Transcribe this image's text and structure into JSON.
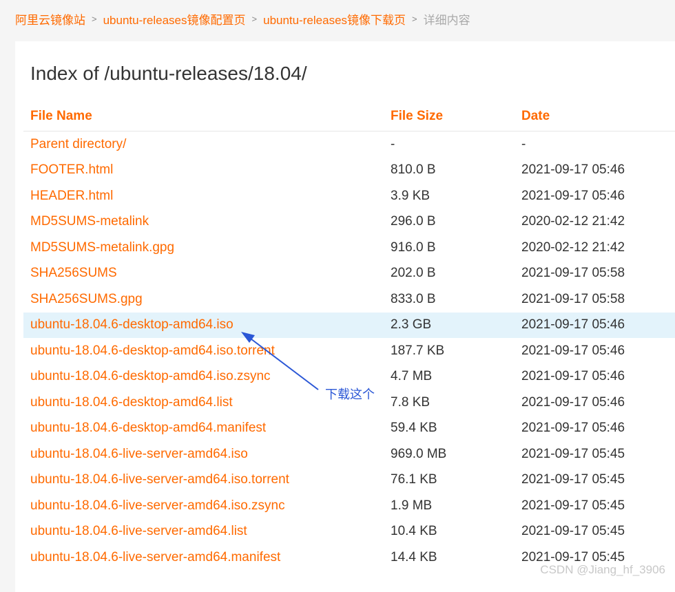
{
  "breadcrumb": {
    "items": [
      "阿里云镜像站",
      "ubuntu-releases镜像配置页",
      "ubuntu-releases镜像下载页"
    ],
    "current": "详细内容",
    "separator": ">"
  },
  "page": {
    "title": "Index of /ubuntu-releases/18.04/"
  },
  "table": {
    "columns": [
      "File Name",
      "File Size",
      "Date"
    ],
    "rows": [
      {
        "name": "Parent directory/",
        "size": "-",
        "date": "-"
      },
      {
        "name": "FOOTER.html",
        "size": "810.0 B",
        "date": "2021-09-17 05:46"
      },
      {
        "name": "HEADER.html",
        "size": "3.9 KB",
        "date": "2021-09-17 05:46"
      },
      {
        "name": "MD5SUMS-metalink",
        "size": "296.0 B",
        "date": "2020-02-12 21:42"
      },
      {
        "name": "MD5SUMS-metalink.gpg",
        "size": "916.0 B",
        "date": "2020-02-12 21:42"
      },
      {
        "name": "SHA256SUMS",
        "size": "202.0 B",
        "date": "2021-09-17 05:58"
      },
      {
        "name": "SHA256SUMS.gpg",
        "size": "833.0 B",
        "date": "2021-09-17 05:58"
      },
      {
        "name": "ubuntu-18.04.6-desktop-amd64.iso",
        "size": "2.3 GB",
        "date": "2021-09-17 05:46"
      },
      {
        "name": "ubuntu-18.04.6-desktop-amd64.iso.torrent",
        "size": "187.7 KB",
        "date": "2021-09-17 05:46"
      },
      {
        "name": "ubuntu-18.04.6-desktop-amd64.iso.zsync",
        "size": "4.7 MB",
        "date": "2021-09-17 05:46"
      },
      {
        "name": "ubuntu-18.04.6-desktop-amd64.list",
        "size": "7.8 KB",
        "date": "2021-09-17 05:46"
      },
      {
        "name": "ubuntu-18.04.6-desktop-amd64.manifest",
        "size": "59.4 KB",
        "date": "2021-09-17 05:46"
      },
      {
        "name": "ubuntu-18.04.6-live-server-amd64.iso",
        "size": "969.0 MB",
        "date": "2021-09-17 05:45"
      },
      {
        "name": "ubuntu-18.04.6-live-server-amd64.iso.torrent",
        "size": "76.1 KB",
        "date": "2021-09-17 05:45"
      },
      {
        "name": "ubuntu-18.04.6-live-server-amd64.iso.zsync",
        "size": "1.9 MB",
        "date": "2021-09-17 05:45"
      },
      {
        "name": "ubuntu-18.04.6-live-server-amd64.list",
        "size": "10.4 KB",
        "date": "2021-09-17 05:45"
      },
      {
        "name": "ubuntu-18.04.6-live-server-amd64.manifest",
        "size": "14.4 KB",
        "date": "2021-09-17 05:45"
      }
    ]
  },
  "annotation": {
    "text": "下载这个",
    "color": "#2b57d6"
  },
  "watermark": "CSDN @Jiang_hf_3906",
  "colors": {
    "link": "#ff6a00",
    "highlight_row": "#e3f3fb",
    "muted": "#aaaaaa"
  }
}
